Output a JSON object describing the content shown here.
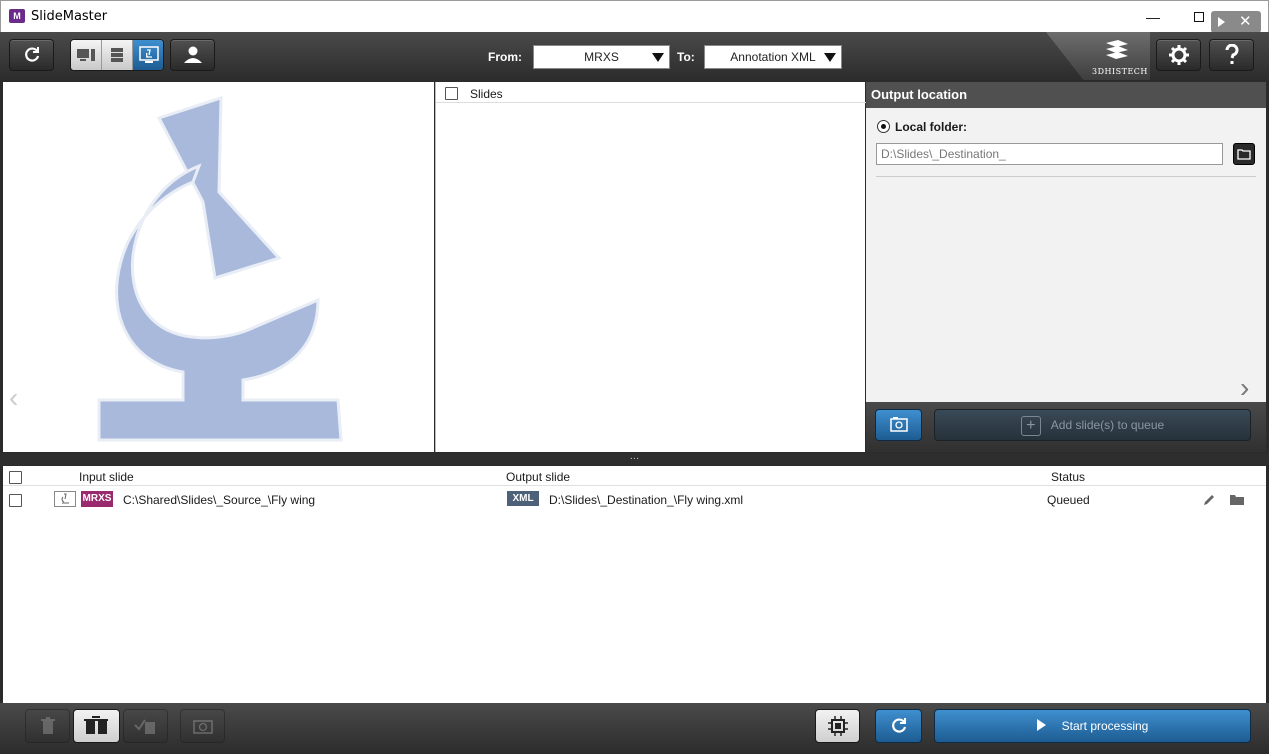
{
  "window": {
    "title": "SlideMaster",
    "app_icon_text": "M"
  },
  "toolbar": {
    "from_label": "From:",
    "from_value": "MRXS",
    "to_label": "To:",
    "to_value": "Annotation XML",
    "brand_text": "3DHISTECH",
    "view_mode_active": "scanner-view"
  },
  "slides_panel": {
    "header_label": "Slides"
  },
  "output_panel": {
    "title": "Output location",
    "local_folder_label": "Local folder:",
    "local_folder_value": "D:\\Slides\\_Destination_",
    "add_to_queue_label": "Add slide(s) to queue"
  },
  "queue": {
    "columns": {
      "input": "Input slide",
      "output": "Output slide",
      "status": "Status"
    },
    "rows": [
      {
        "input_format": "MRXS",
        "input_path": "C:\\Shared\\Slides\\_Source_\\Fly wing",
        "output_format": "XML",
        "output_path": "D:\\Slides\\_Destination_\\Fly wing.xml",
        "status": "Queued"
      }
    ]
  },
  "bottom": {
    "start_label": "Start processing"
  },
  "colors": {
    "accent_blue": "#2a74b3",
    "mrxs_badge": "#9a2a6e",
    "xml_badge": "#4d6278",
    "logo_fill": "#a9b9db"
  }
}
